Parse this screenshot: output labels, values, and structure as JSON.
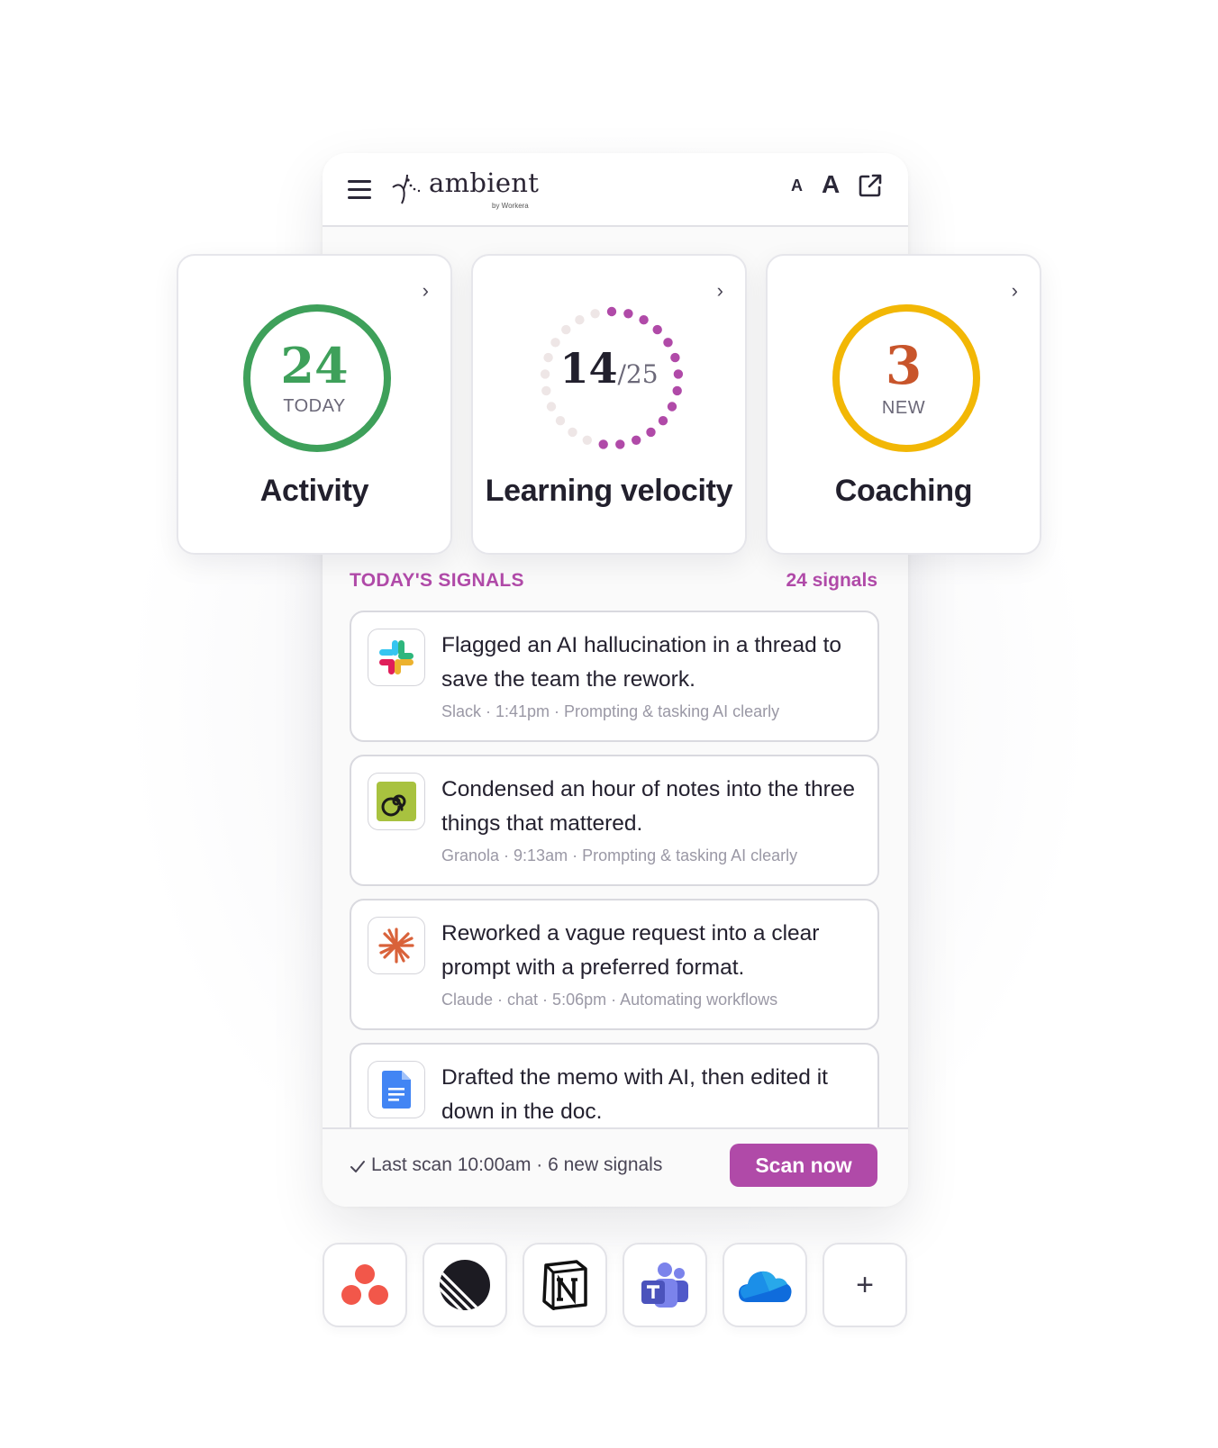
{
  "header": {
    "logo_text": "ambient",
    "logo_sub": "by Workera",
    "font_small_label": "A",
    "font_large_label": "A",
    "icons": [
      "menu-icon",
      "ambient-logo-icon",
      "external-link-icon"
    ]
  },
  "metrics": {
    "activity": {
      "value": "24",
      "sub": "TODAY",
      "label": "Activity",
      "color": "#3ea05a",
      "chevron": "›"
    },
    "velocity": {
      "value": "14",
      "total": "/25",
      "label": "Learning velocity",
      "done": 14,
      "of": 25,
      "color": "#b04aa8",
      "chevron": "›"
    },
    "coaching": {
      "value": "3",
      "sub": "NEW",
      "label": "Coaching",
      "color": "#f2b705",
      "num_color": "#c8552b",
      "chevron": "›"
    }
  },
  "signals": {
    "title": "TODAY'S SIGNALS",
    "count_label": "24 signals",
    "items": [
      {
        "app": "slack-icon",
        "text": "Flagged an AI hallucination in a thread to save the team the rework.",
        "meta": "Slack · 1:41pm · Prompting & tasking AI clearly"
      },
      {
        "app": "granola-icon",
        "text": "Condensed an hour of notes into the three things that mattered.",
        "meta": "Granola · 9:13am · Prompting & tasking AI clearly"
      },
      {
        "app": "claude-icon",
        "text": "Reworked a vague request into a clear prompt with a preferred format.",
        "meta": "Claude · chat · 5:06pm · Automating workflows"
      },
      {
        "app": "google-docs-icon",
        "text": "Drafted the memo with AI, then edited it down in the doc.",
        "meta": ""
      }
    ]
  },
  "footer": {
    "scan_status": "Last scan 10:00am · 6 new signals",
    "scan_button": "Scan now"
  },
  "integrations": {
    "items": [
      "asana-icon",
      "linear-icon",
      "notion-icon",
      "teams-icon",
      "onedrive-icon",
      "add-integration-icon"
    ],
    "add_label": "+"
  },
  "colors": {
    "accent": "#b04aa8",
    "activity": "#3ea05a",
    "coaching": "#f2b705"
  }
}
